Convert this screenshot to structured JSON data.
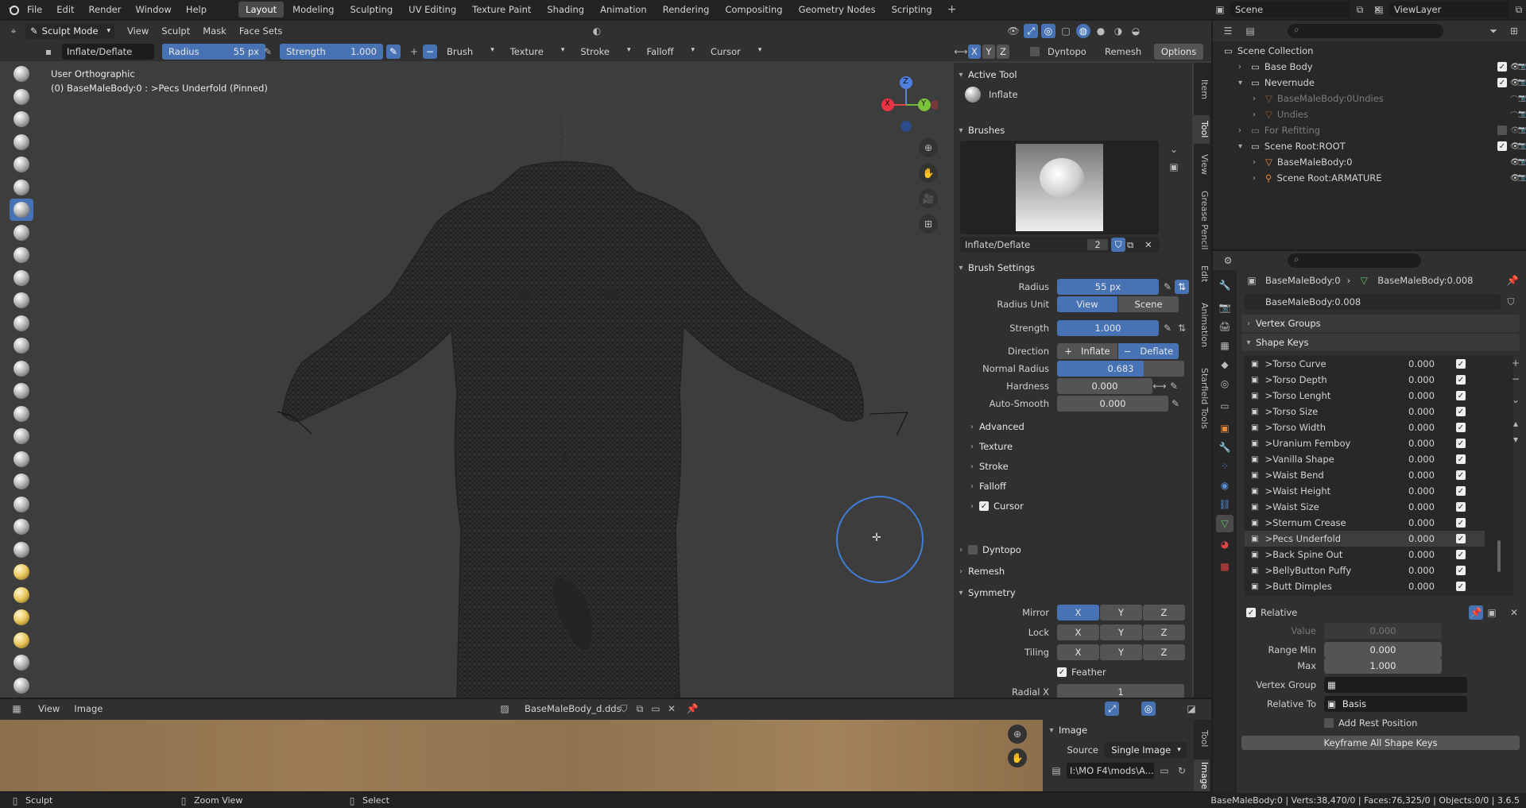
{
  "menu": {
    "items": [
      "File",
      "Edit",
      "Render",
      "Window",
      "Help"
    ]
  },
  "workspaces": [
    "Layout",
    "Modeling",
    "Sculpting",
    "UV Editing",
    "Texture Paint",
    "Shading",
    "Animation",
    "Rendering",
    "Compositing",
    "Geometry Nodes",
    "Scripting"
  ],
  "scene": {
    "name": "Scene",
    "view_layer": "ViewLayer"
  },
  "header": {
    "mode": "Sculpt Mode",
    "menus": [
      "View",
      "Sculpt",
      "Mask",
      "Face Sets"
    ]
  },
  "tool_settings": {
    "brush_name": "Inflate/Deflate",
    "radius_label": "Radius",
    "radius_value": "55 px",
    "strength_label": "Strength",
    "strength_value": "1.000",
    "menus": [
      "Brush",
      "Texture",
      "Stroke",
      "Falloff",
      "Cursor"
    ],
    "axis": [
      "X",
      "Y",
      "Z"
    ],
    "dyntopo": "Dyntopo",
    "remesh": "Remesh",
    "options": "Options"
  },
  "viewport": {
    "view_name": "User Orthographic",
    "object_info": "(0) BaseMaleBody:0 : >Pecs Underfold (Pinned)",
    "gizmo": {
      "x": "X",
      "y": "Y",
      "z": "Z"
    }
  },
  "sidebar_tabs": [
    "Item",
    "Tool",
    "View",
    "Grease Pencil",
    "Edit",
    "Animation",
    "Starfield Tools"
  ],
  "npanel": {
    "active_tool_title": "Active Tool",
    "active_tool": "Inflate",
    "brushes_title": "Brushes",
    "brush_name": "Inflate/Deflate",
    "brush_users": "2",
    "brush_settings_title": "Brush Settings",
    "radius_label": "Radius",
    "radius": "55 px",
    "radius_unit_label": "Radius Unit",
    "radius_unit_view": "View",
    "radius_unit_scene": "Scene",
    "strength_label": "Strength",
    "strength": "1.000",
    "direction_label": "Direction",
    "direction_inflate": "Inflate",
    "direction_deflate": "Deflate",
    "normal_radius_label": "Normal Radius",
    "normal_radius": "0.683",
    "normal_radius_fraction": 0.683,
    "hardness_label": "Hardness",
    "hardness": "0.000",
    "autosmooth_label": "Auto-Smooth",
    "autosmooth": "0.000",
    "subpanels": [
      "Advanced",
      "Texture",
      "Stroke",
      "Falloff",
      "Cursor"
    ],
    "dyntopo": "Dyntopo",
    "remesh": "Remesh",
    "symmetry_title": "Symmetry",
    "mirror_label": "Mirror",
    "lock_label": "Lock",
    "tiling_label": "Tiling",
    "axes": [
      "X",
      "Y",
      "Z"
    ],
    "feather": "Feather",
    "radial_label": "Radial X",
    "radial": "1"
  },
  "image_editor": {
    "menus": [
      "View",
      "Image"
    ],
    "image_name": "BaseMaleBody_d.dds",
    "panel_title": "Image",
    "source_label": "Source",
    "source": "Single Image",
    "filepath": "I:\\MO F4\\mods\\A...",
    "tabs": [
      "Tool",
      "Image"
    ]
  },
  "outliner": {
    "items": [
      {
        "label": "Scene Collection",
        "indent": 0,
        "icon": "collection-icon",
        "muted": false
      },
      {
        "label": "Base Body",
        "indent": 1,
        "icon": "collection-icon",
        "muted": false
      },
      {
        "label": "Nevernude",
        "indent": 1,
        "icon": "collection-icon",
        "muted": false
      },
      {
        "label": "BaseMaleBody:0Undies",
        "indent": 2,
        "icon": "mesh-icon",
        "muted": true
      },
      {
        "label": "Undies",
        "indent": 2,
        "icon": "mesh-icon",
        "muted": true
      },
      {
        "label": "For Refitting",
        "indent": 1,
        "icon": "collection-icon",
        "muted": true
      },
      {
        "label": "Scene Root:ROOT",
        "indent": 1,
        "icon": "collection-icon",
        "muted": false
      },
      {
        "label": "BaseMaleBody:0",
        "indent": 2,
        "icon": "mesh-icon",
        "muted": false
      },
      {
        "label": "Scene Root:ARMATURE",
        "indent": 2,
        "icon": "armature-icon",
        "muted": false
      }
    ]
  },
  "properties": {
    "breadcrumb_object": "BaseMaleBody:0",
    "breadcrumb_mesh": "BaseMaleBody:0.008",
    "mesh_name": "BaseMaleBody:0.008",
    "vertex_groups": "Vertex Groups",
    "shape_keys_title": "Shape Keys",
    "shape_keys": [
      {
        "name": ">Torso Curve",
        "value": "0.000"
      },
      {
        "name": ">Torso Depth",
        "value": "0.000"
      },
      {
        "name": ">Torso Lenght",
        "value": "0.000"
      },
      {
        "name": ">Torso Size",
        "value": "0.000"
      },
      {
        "name": ">Torso Width",
        "value": "0.000"
      },
      {
        "name": ">Uranium Femboy",
        "value": "0.000"
      },
      {
        "name": ">Vanilla Shape",
        "value": "0.000"
      },
      {
        "name": ">Waist Bend",
        "value": "0.000"
      },
      {
        "name": ">Waist Height",
        "value": "0.000"
      },
      {
        "name": ">Waist Size",
        "value": "0.000"
      },
      {
        "name": ">Sternum Crease",
        "value": "0.000"
      },
      {
        "name": ">Pecs Underfold",
        "value": "0.000"
      },
      {
        "name": ">Back Spine Out",
        "value": "0.000"
      },
      {
        "name": ">BellyButton Puffy",
        "value": "0.000"
      },
      {
        "name": ">Butt Dimples",
        "value": "0.000"
      }
    ],
    "relative": "Relative",
    "value_label": "Value",
    "value": "0.000",
    "range_min_label": "Range Min",
    "range_min": "0.000",
    "max_label": "Max",
    "max": "1.000",
    "vertex_group_label": "Vertex Group",
    "relative_to_label": "Relative To",
    "relative_to": "Basis",
    "add_rest": "Add Rest Position",
    "keyframe_all": "Keyframe All Shape Keys"
  },
  "status": {
    "left": "Sculpt",
    "middle": "Zoom View",
    "right": "Select",
    "stats": "BaseMaleBody:0 | Verts:38,470/0 | Faces:76,325/0 | Objects:0/0 | 3.6.5"
  },
  "colors": {
    "accent": "#4772b3",
    "bg": "#303030",
    "viewport": "#3d3d3d"
  }
}
